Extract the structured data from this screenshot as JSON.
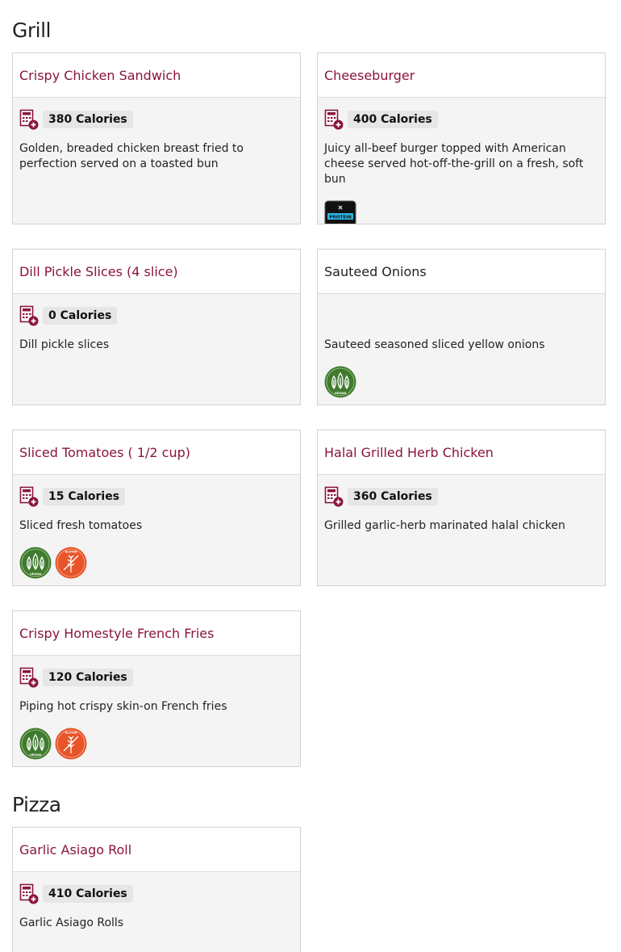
{
  "sections": [
    {
      "title": "Grill",
      "items": [
        {
          "name": "Crispy Chicken Sandwich",
          "calories": "380 Calories",
          "description": "Golden, breaded chicken breast fried to perfection served on a toasted bun"
        },
        {
          "name": "Cheeseburger",
          "calories": "400 Calories",
          "description": "Juicy all-beef burger topped with American cheese served hot-off-the-grill on a fresh, soft bun",
          "badges": [
            "protein"
          ]
        },
        {
          "name": "Dill Pickle Slices (4 slice)",
          "calories": "0 Calories",
          "description": "Dill pickle slices"
        },
        {
          "name": "Sauteed Onions",
          "calories": "",
          "description": "Sauteed seasoned sliced yellow onions",
          "badges": [
            "vegan"
          ]
        },
        {
          "name": "Sliced Tomatoes ( 1/2 cup)",
          "calories": "15 Calories",
          "description": "Sliced fresh tomatoes",
          "badges": [
            "vegan",
            "gluten-free"
          ]
        },
        {
          "name": "Halal Grilled Herb Chicken",
          "calories": "360 Calories",
          "description": "Grilled garlic-herb marinated halal chicken"
        },
        {
          "name": "Crispy Homestyle French Fries",
          "calories": "120 Calories",
          "description": "Piping hot crispy skin-on French fries",
          "badges": [
            "vegan",
            "gluten-free"
          ]
        }
      ]
    },
    {
      "title": "Pizza",
      "items": [
        {
          "name": "Garlic Asiago Roll",
          "calories": "410 Calories",
          "description": "Garlic Asiago Rolls"
        }
      ]
    }
  ],
  "badge_labels": {
    "protein": "PROTEIN",
    "vegan": "VEGAN",
    "gluten_free": "GLUTEN"
  },
  "colors": {
    "accent": "#8a1538",
    "card_bg": "#f4f4f4",
    "vegan": "#3f7a2e",
    "gluten_free": "#e8542a",
    "protein": "#111111"
  }
}
